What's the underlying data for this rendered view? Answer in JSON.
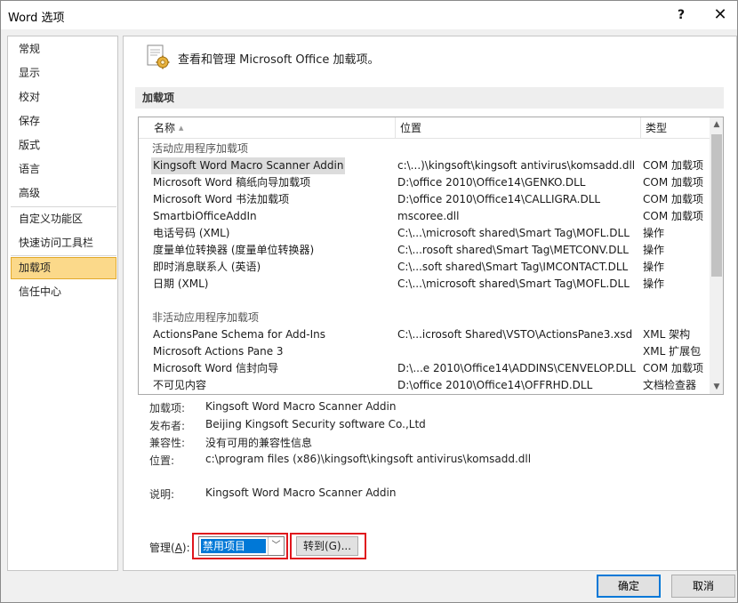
{
  "window": {
    "title": "Word 选项",
    "help": "?",
    "close": "✕"
  },
  "nav": {
    "items": [
      {
        "label": "常规"
      },
      {
        "label": "显示"
      },
      {
        "label": "校对"
      },
      {
        "label": "保存"
      },
      {
        "label": "版式"
      },
      {
        "label": "语言"
      },
      {
        "label": "高级"
      },
      {
        "label": "自定义功能区"
      },
      {
        "label": "快速访问工具栏"
      },
      {
        "label": "加载项",
        "active": true
      },
      {
        "label": "信任中心"
      }
    ]
  },
  "header": {
    "text": "查看和管理 Microsoft Office 加载项。",
    "icon": "addins-gear-icon"
  },
  "section_title": "加载项",
  "table": {
    "columns": {
      "name": "名称",
      "location": "位置",
      "type": "类型"
    },
    "active_group": "活动应用程序加载项",
    "active_rows": [
      {
        "name": "Kingsoft Word Macro Scanner Addin",
        "location": "c:\\...)\\kingsoft\\kingsoft antivirus\\komsadd.dll",
        "type": "COM 加载项"
      },
      {
        "name": "Microsoft Word 稿纸向导加载项",
        "location": "D:\\office 2010\\Office14\\GENKO.DLL",
        "type": "COM 加载项"
      },
      {
        "name": "Microsoft Word 书法加载项",
        "location": "D:\\office 2010\\Office14\\CALLIGRA.DLL",
        "type": "COM 加载项"
      },
      {
        "name": "SmartbiOfficeAddIn",
        "location": "mscoree.dll",
        "type": "COM 加载项"
      },
      {
        "name": "电话号码 (XML)",
        "location": "C:\\...\\microsoft shared\\Smart Tag\\MOFL.DLL",
        "type": "操作"
      },
      {
        "name": "度量单位转换器 (度量单位转换器)",
        "location": "C:\\...rosoft shared\\Smart Tag\\METCONV.DLL",
        "type": "操作"
      },
      {
        "name": "即时消息联系人 (英语)",
        "location": "C:\\...soft shared\\Smart Tag\\IMCONTACT.DLL",
        "type": "操作"
      },
      {
        "name": "日期 (XML)",
        "location": "C:\\...\\microsoft shared\\Smart Tag\\MOFL.DLL",
        "type": "操作"
      }
    ],
    "inactive_group": "非活动应用程序加载项",
    "inactive_rows": [
      {
        "name": "ActionsPane Schema for Add-Ins",
        "location": "C:\\...icrosoft Shared\\VSTO\\ActionsPane3.xsd",
        "type": "XML 架构"
      },
      {
        "name": "Microsoft Actions Pane 3",
        "location": "",
        "type": "XML 扩展包"
      },
      {
        "name": "Microsoft Word 信封向导",
        "location": "D:\\...e 2010\\Office14\\ADDINS\\CENVELOP.DLL",
        "type": "COM 加载项"
      },
      {
        "name": "不可见内容",
        "location": "D:\\office 2010\\Office14\\OFFRHD.DLL",
        "type": "文档检查器"
      }
    ]
  },
  "details": {
    "addin_label": "加载项:",
    "addin_value": "Kingsoft Word Macro Scanner Addin",
    "publisher_label": "发布者:",
    "publisher_value": "Beijing Kingsoft Security software Co.,Ltd",
    "compat_label": "兼容性:",
    "compat_value": "没有可用的兼容性信息",
    "location_label": "位置:",
    "location_value": "c:\\program files (x86)\\kingsoft\\kingsoft antivirus\\komsadd.dll",
    "desc_label": "说明:",
    "desc_value": "Kingsoft Word Macro Scanner Addin"
  },
  "manage": {
    "label_pre": "管理(",
    "label_key": "A",
    "label_post": "):",
    "selected": "禁用项目",
    "goto_label": "转到(G)...",
    "highlight_color": "#e0161d"
  },
  "footer": {
    "ok": "确定",
    "cancel": "取消"
  },
  "colors": {
    "accent": "#0078d7",
    "nav_active_bg": "#fbd98a",
    "nav_active_border": "#e2a92a"
  }
}
